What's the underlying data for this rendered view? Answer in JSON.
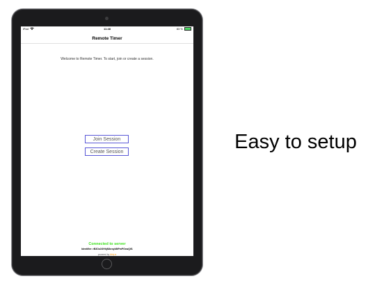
{
  "status_bar": {
    "carrier": "iPad",
    "wifi_icon": "wifi-icon",
    "time": "11:48",
    "battery_text": "83 %",
    "battery_color": "#4cd964"
  },
  "app": {
    "title": "Remote Timer",
    "welcome": "Welcome to Remote Timer. To start, join or create a session.",
    "join_label": "Join Session",
    "create_label": "Create Session",
    "connection_status": "Connected to server",
    "connection_color": "#3be11a",
    "identifier": "Identifier: rB3Oo1KHhjfUkroyb5tPmPGxwQif1",
    "powered_prefix": "powered by",
    "powered_brand": "Ably.io"
  },
  "headline": "Easy to setup",
  "colors": {
    "button_border": "#5856d6",
    "device_frame": "#1b1b1d"
  }
}
